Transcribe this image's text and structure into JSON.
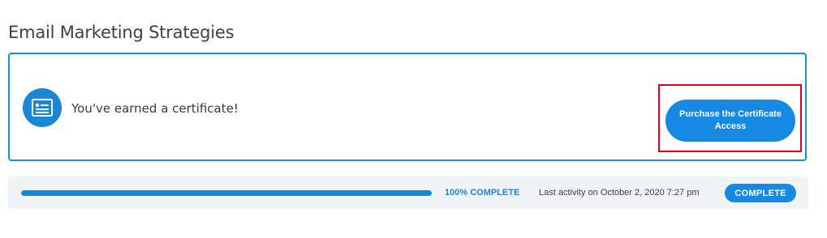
{
  "page": {
    "title": "Email Marketing Strategies"
  },
  "certificate": {
    "icon": "certificate-icon",
    "message": "You've earned a certificate!",
    "button_label": "Purchase the Certificate Access"
  },
  "progress": {
    "percent": 100,
    "label": "100% COMPLETE",
    "last_activity": "Last activity on October 2, 2020 7:27 pm",
    "status": "COMPLETE"
  },
  "colors": {
    "accent": "#1589e3",
    "card_border": "#1f8fce",
    "highlight": "#d9001b",
    "row_background": "#eff3f6"
  }
}
